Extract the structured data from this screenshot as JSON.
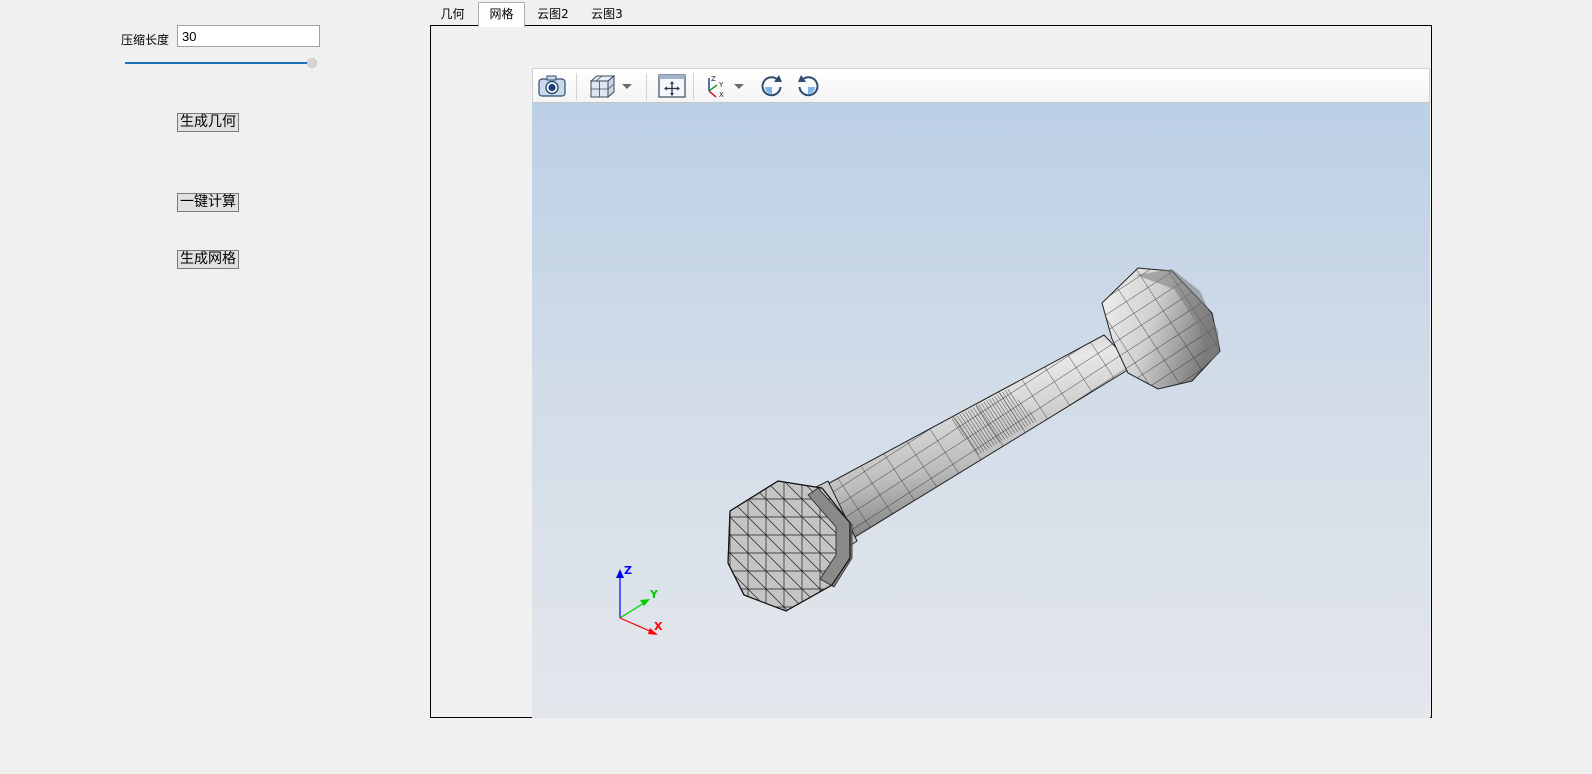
{
  "left_panel": {
    "compress_label": "压缩长度",
    "compress_value": "30",
    "slider_value": 1.0,
    "buttons": {
      "gen_geometry": "生成几何",
      "one_click_compute": "一键计算",
      "gen_mesh": "生成网格"
    }
  },
  "tabs": [
    {
      "label": "几何",
      "active": false
    },
    {
      "label": "网格",
      "active": true
    },
    {
      "label": "云图2",
      "active": false
    },
    {
      "label": "云图3",
      "active": false
    }
  ],
  "toolbar": {
    "icons": [
      "camera-icon",
      "cube-view-icon",
      "chevron-down-icon",
      "fit-view-icon",
      "axes-view-icon",
      "chevron-down-icon",
      "rotate-cw-icon",
      "rotate-ccw-icon"
    ]
  },
  "axes": {
    "x": "X",
    "y": "Y",
    "z": "Z"
  },
  "colors": {
    "slider_accent": "#1e6fb8",
    "bg_top": "#bcd0e6",
    "bg_bottom": "#e4e7ec",
    "axis_x": "#ff0000",
    "axis_y": "#00cc00",
    "axis_z": "#0000ff"
  }
}
